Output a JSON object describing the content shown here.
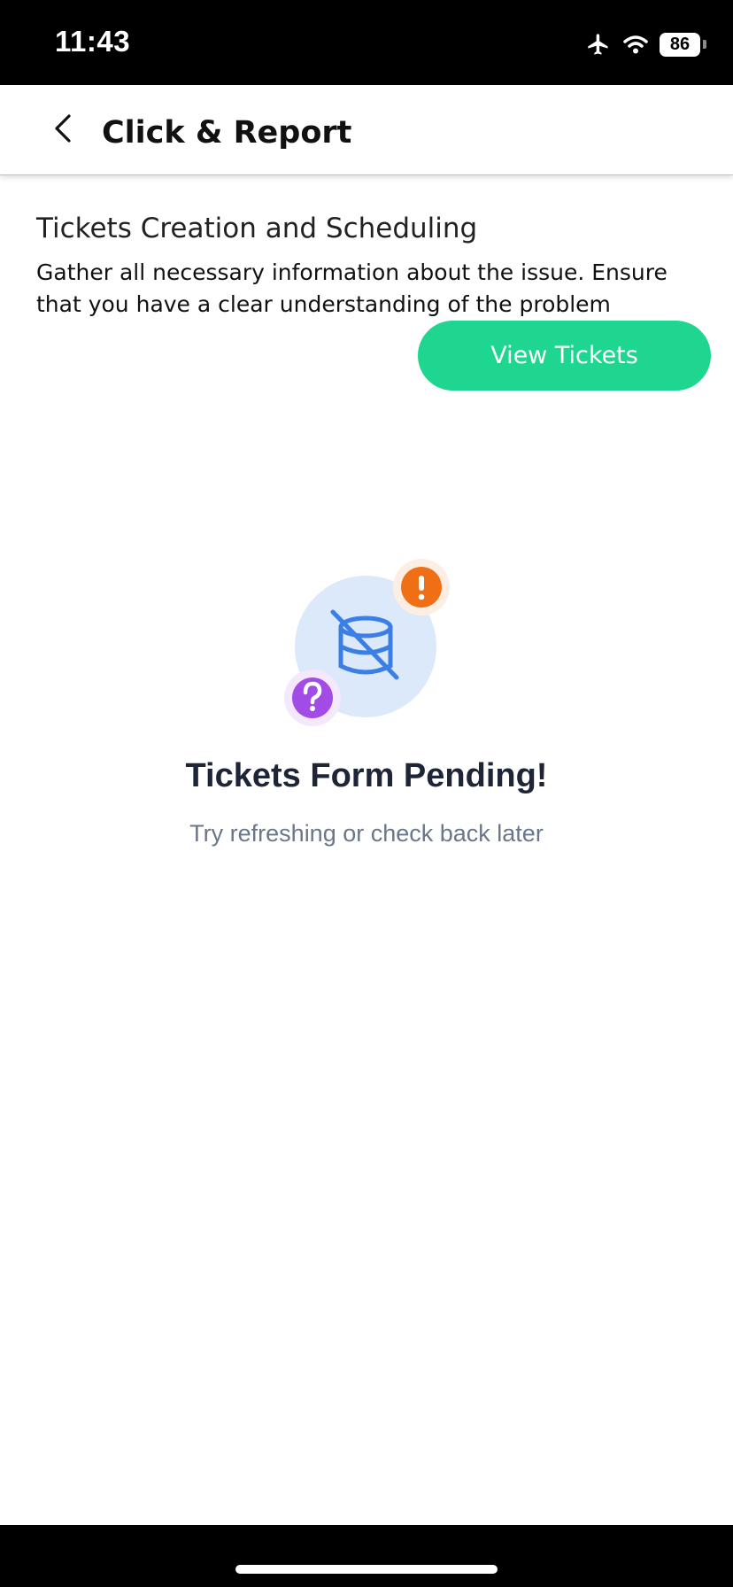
{
  "status_bar": {
    "time": "11:43",
    "battery": "86",
    "icons": [
      "airplane-mode-icon",
      "wifi-icon",
      "battery-icon"
    ]
  },
  "header": {
    "back_icon": "chevron-left-icon",
    "title": "Click & Report"
  },
  "intro": {
    "title": "Tickets Creation and Scheduling",
    "description": "Gather all necessary information about the issue. Ensure that you have a clear understanding of the problem",
    "view_tickets_label": "View Tickets"
  },
  "empty_state": {
    "title": "Tickets Form Pending!",
    "subtitle": "Try refreshing or check back later",
    "icons": [
      "database-off-icon",
      "exclamation-badge-icon",
      "question-badge-icon"
    ]
  },
  "colors": {
    "accent": "#1ed690",
    "title_text": "#1e2536",
    "subtitle_text": "#6a7689",
    "database_icon": "#3b7fe6",
    "database_circle": "#dce9fb",
    "warning_badge": "#f06f16",
    "question_badge": "#a24be6"
  }
}
